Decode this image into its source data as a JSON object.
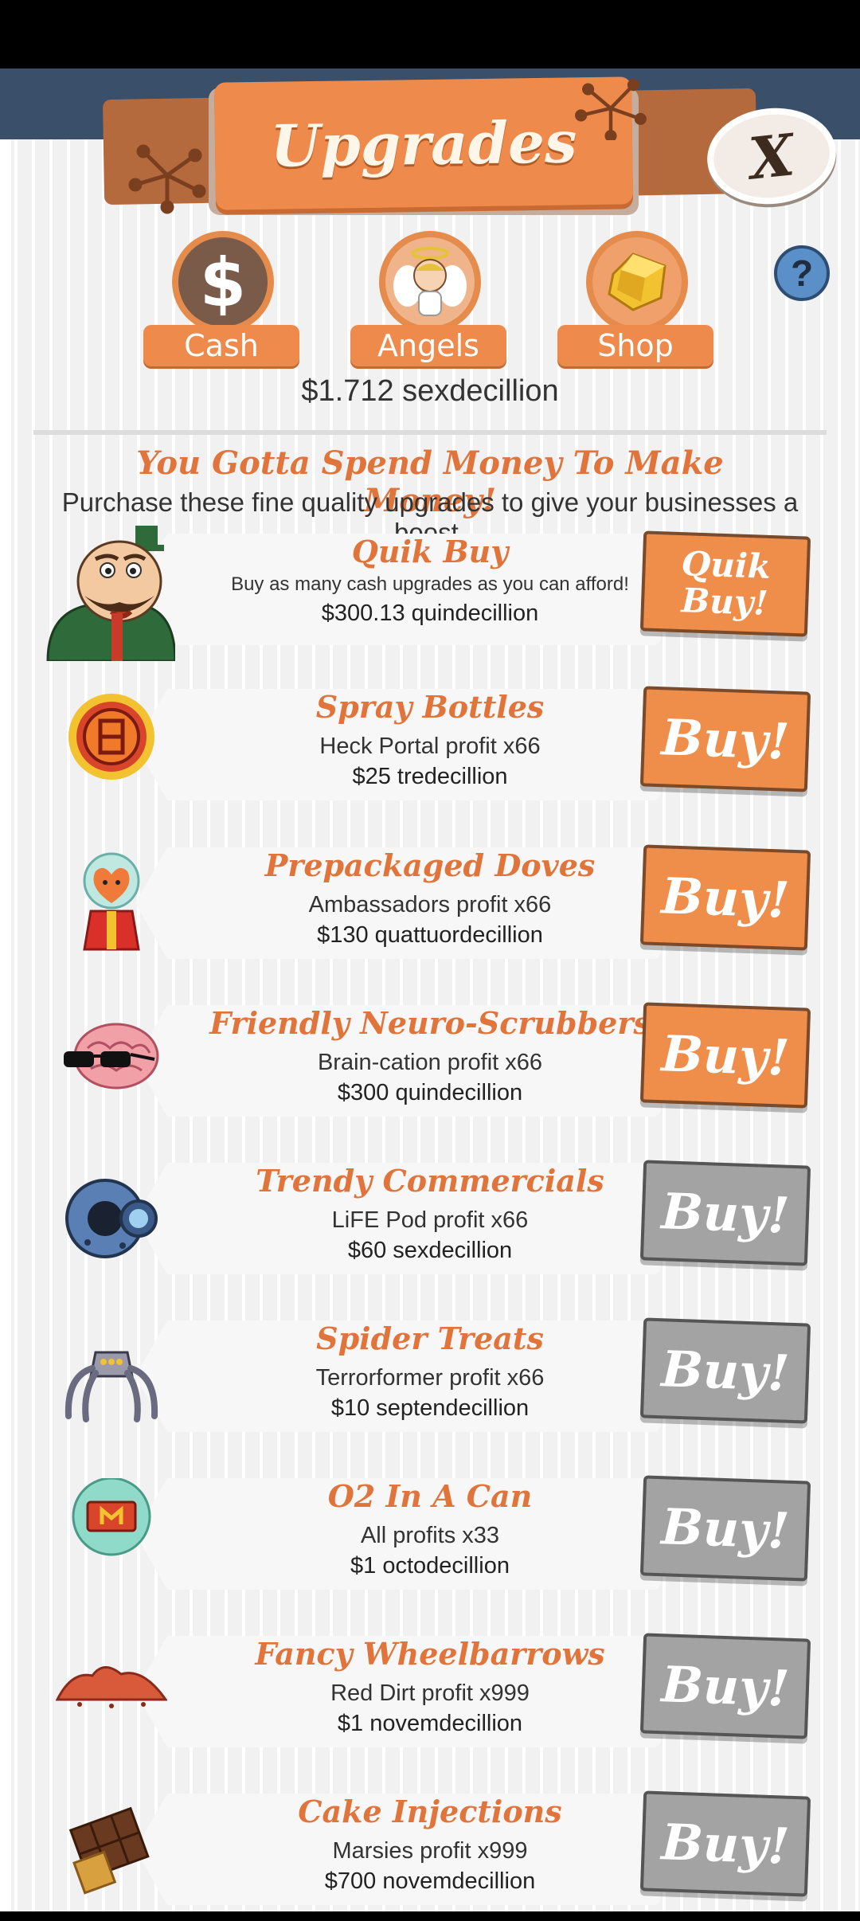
{
  "header": {
    "title": "Upgrades",
    "close_label": "X",
    "help_label": "?"
  },
  "tabs": [
    {
      "label": "Cash",
      "icon": "dollar-icon"
    },
    {
      "label": "Angels",
      "icon": "angel-icon"
    },
    {
      "label": "Shop",
      "icon": "gold-gem-icon"
    }
  ],
  "balance": "$1.712 sexdecillion",
  "intro": {
    "headline": "You Gotta Spend Money To Make Money!",
    "subline": "Purchase these fine quality upgrades to give your businesses a boost."
  },
  "quik_buy": {
    "name": "Quik Buy",
    "description": "Buy as many cash upgrades as you can afford!",
    "price": "$300.13 quindecillion",
    "button_label": "Quik Buy!"
  },
  "upgrades": [
    {
      "name": "Spray Bottles",
      "effect": "Heck Portal profit x66",
      "price": "$25 tredecillion",
      "button_label": "Buy!",
      "affordable": true,
      "icon": "heck-portal-icon"
    },
    {
      "name": "Prepackaged Doves",
      "effect": "Ambassadors profit x66",
      "price": "$130 quattuordecillion",
      "button_label": "Buy!",
      "affordable": true,
      "icon": "ambassador-icon"
    },
    {
      "name": "Friendly Neuro-Scrubbers",
      "effect": "Brain-cation profit x66",
      "price": "$300 quindecillion",
      "button_label": "Buy!",
      "affordable": true,
      "icon": "brain-icon"
    },
    {
      "name": "Trendy Commercials",
      "effect": "LiFE Pod profit x66",
      "price": "$60 sexdecillion",
      "button_label": "Buy!",
      "affordable": false,
      "icon": "life-pod-icon"
    },
    {
      "name": "Spider Treats",
      "effect": "Terrorformer profit x66",
      "price": "$10 septendecillion",
      "button_label": "Buy!",
      "affordable": false,
      "icon": "spider-robot-icon"
    },
    {
      "name": "O2 In A Can",
      "effect": "All profits x33",
      "price": "$1 octodecillion",
      "button_label": "Buy!",
      "affordable": false,
      "icon": "oxygen-can-icon"
    },
    {
      "name": "Fancy Wheelbarrows",
      "effect": "Red Dirt profit x999",
      "price": "$1 novemdecillion",
      "button_label": "Buy!",
      "affordable": false,
      "icon": "red-dirt-icon"
    },
    {
      "name": "Cake Injections",
      "effect": "Marsies profit x999",
      "price": "$700 novemdecillion",
      "button_label": "Buy!",
      "affordable": false,
      "icon": "chocolate-bar-icon"
    }
  ],
  "colors": {
    "accent_orange": "#ee8a4c",
    "title_orange": "#e0743a",
    "disabled_gray": "#a3a3a3"
  }
}
